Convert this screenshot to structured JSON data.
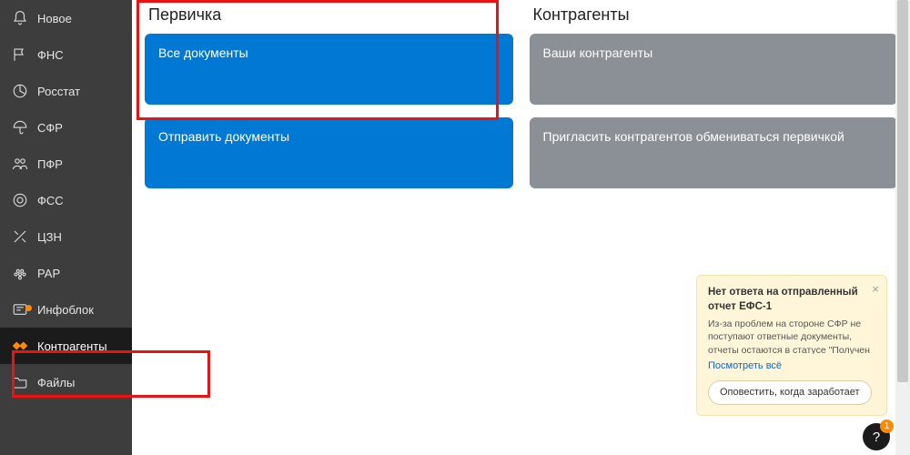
{
  "sidebar": {
    "items": [
      {
        "label": "Новое",
        "icon": "bell"
      },
      {
        "label": "ФНС",
        "icon": "flag"
      },
      {
        "label": "Росстат",
        "icon": "pie"
      },
      {
        "label": "СФР",
        "icon": "umbrella"
      },
      {
        "label": "ПФР",
        "icon": "people"
      },
      {
        "label": "ФСС",
        "icon": "target"
      },
      {
        "label": "ЦЗН",
        "icon": "tools"
      },
      {
        "label": "РАР",
        "icon": "grapes"
      },
      {
        "label": "Инфоблок",
        "icon": "newspaper",
        "badge": true
      },
      {
        "label": "Контрагенты",
        "icon": "handshake",
        "active": true
      },
      {
        "label": "Файлы",
        "icon": "folder"
      }
    ]
  },
  "columns": {
    "left": {
      "title": "Первичка",
      "cards": [
        {
          "label": "Все документы",
          "style": "blue"
        },
        {
          "label": "Отправить документы",
          "style": "blue"
        }
      ]
    },
    "right": {
      "title": "Контрагенты",
      "cards": [
        {
          "label": "Ваши контрагенты",
          "style": "gray"
        },
        {
          "label": "Пригласить контрагентов обмениваться первичкой",
          "style": "gray"
        }
      ]
    }
  },
  "toast": {
    "title": "Нет ответа на отправленный отчет ЕФС-1",
    "body": "Из-за проблем на стороне СФР не поступают ответные документы, отчеты остаются в статусе \"Получен в СФР\". Повторно",
    "link": "Посмотреть всё",
    "button": "Оповестить, когда заработает"
  },
  "help": {
    "glyph": "?",
    "badge": "1"
  }
}
